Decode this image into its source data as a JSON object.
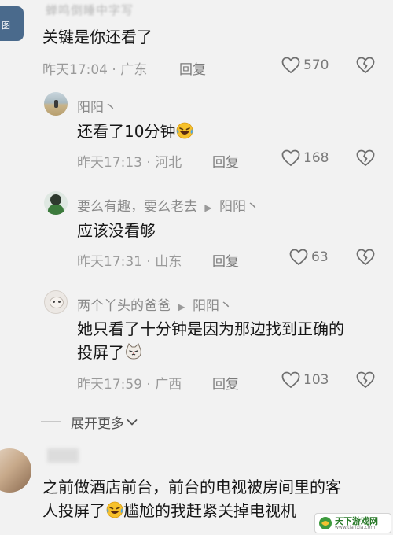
{
  "top_comment": {
    "author_blurred": "蝉鸣倒睡中字写",
    "text": "关键是你还看了",
    "time": "昨天17:04",
    "location": "广东",
    "reply_label": "回复",
    "likes": "570"
  },
  "replies": [
    {
      "author": "阳阳丶",
      "text": "还看了10分钟",
      "emoji": "laughing-tears-emoji",
      "time": "昨天17:13",
      "location": "河北",
      "reply_label": "回复",
      "likes": "168"
    },
    {
      "author": "要么有趣，要么老去",
      "reply_to": "阳阳丶",
      "text": "应该没看够",
      "time": "昨天17:31",
      "location": "山东",
      "reply_label": "回复",
      "likes": "63"
    },
    {
      "author": "两个丫头的爸爸",
      "reply_to": "阳阳丶",
      "text_line1": "她只看了十分钟是因为那边找到正确的",
      "text_line2": "投屏了",
      "emoji": "cat-face-emoji",
      "time": "昨天17:59",
      "location": "广西",
      "reply_label": "回复",
      "likes": "103"
    }
  ],
  "expand_more": "展开更多",
  "second_comment": {
    "text_line1": "之前做酒店前台，前台的电视被房间里的客",
    "text_line2_a": "人投屏了",
    "text_line2_b": "尴尬的我赶紧关掉电视机",
    "emoji": "laughing-tears-emoji"
  },
  "watermark": "天下游戏网",
  "watermark_url": "www.tianxia.com",
  "colors": {
    "background": "#f2f2f2",
    "text_primary": "#161616",
    "text_secondary": "#9a9a9a"
  }
}
